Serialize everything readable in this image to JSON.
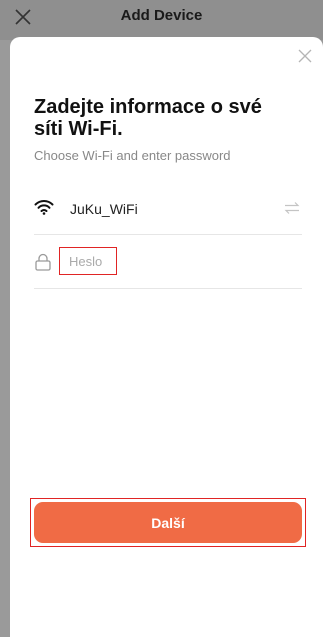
{
  "background_header": {
    "title": "Add Device",
    "close_icon": "close-icon"
  },
  "sheet": {
    "close_icon": "close-icon",
    "heading": "Zadejte informace o své síti Wi-Fi.",
    "subheading": "Choose Wi-Fi and enter password",
    "wifi": {
      "icon": "wifi-icon",
      "network_name": "JuKu_WiFi",
      "switch_icon": "switch-network-icon"
    },
    "password": {
      "icon": "lock-icon",
      "value": "",
      "placeholder": "Heslo"
    },
    "next_button": {
      "label": "Další"
    }
  },
  "colors": {
    "accent": "#f06b45",
    "highlight_border": "#e02424",
    "overlay": "#9a9a9a"
  }
}
